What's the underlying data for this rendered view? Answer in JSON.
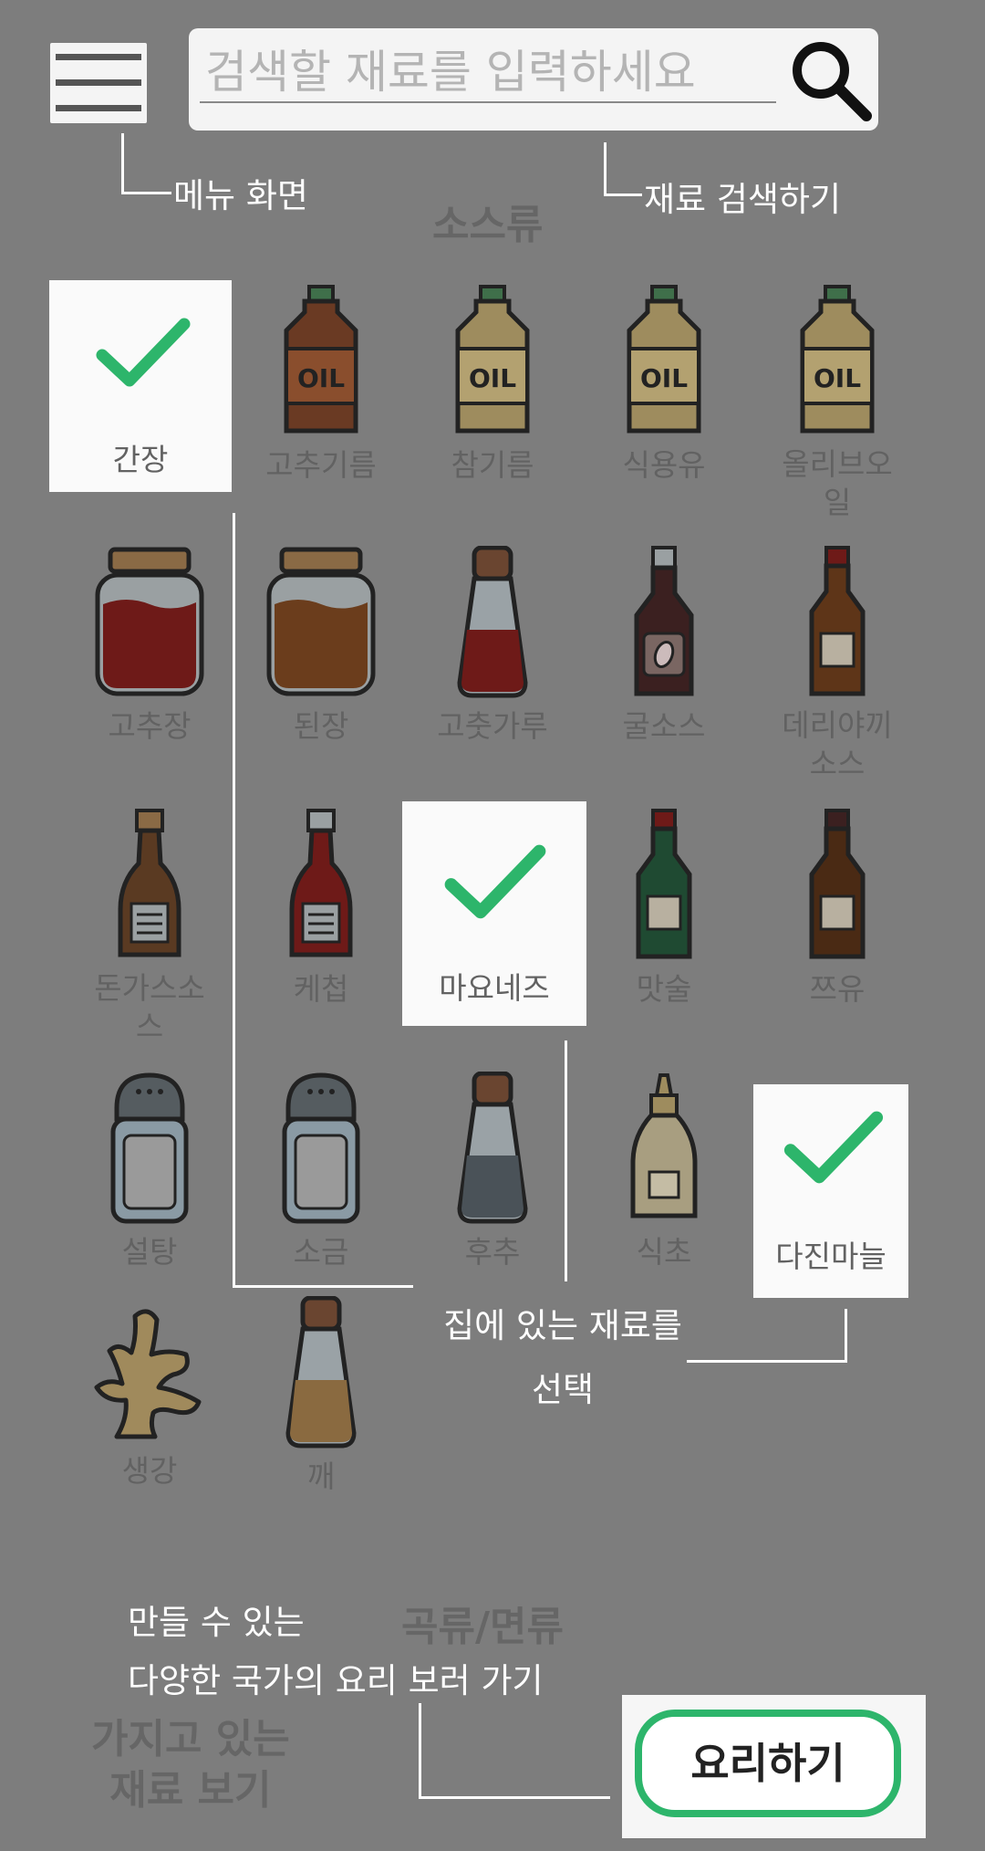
{
  "search": {
    "placeholder": "검색할 재료를 입력하세요"
  },
  "annotations": {
    "menu": "메뉴 화면",
    "search": "재료 검색하기",
    "select_line1": "집에 있는 재료를",
    "select_line2": "선택",
    "cook_line1": "만들 수 있는",
    "cook_line2": "다양한 국가의 요리 보러 가기",
    "owned_line1": "가지고 있는",
    "owned_line2": "재료 보기"
  },
  "sections": {
    "sauce": "소스류",
    "grain": "곡류/면류"
  },
  "ingredients": {
    "soy": "간장",
    "chili_oil": "고추기름",
    "sesame_oil": "참기름",
    "cooking_oil": "식용유",
    "olive_oil_1": "올리브오",
    "olive_oil_2": "일",
    "gochujang": "고추장",
    "doenjang": "된장",
    "chili_powder": "고춧가루",
    "oyster": "굴소스",
    "teriyaki_1": "데리야끼",
    "teriyaki_2": "소스",
    "tonkatsu_1": "돈가스소",
    "tonkatsu_2": "스",
    "ketchup": "케첩",
    "mayo": "마요네즈",
    "mirin": "맛술",
    "tsuyu": "쯔유",
    "sugar": "설탕",
    "salt": "소금",
    "pepper": "후추",
    "vinegar": "식초",
    "garlic": "다진마늘",
    "ginger": "생강",
    "sesame": "깨"
  },
  "selected": [
    "간장",
    "마요네즈",
    "다진마늘"
  ],
  "cook_button": "요리하기",
  "colors": {
    "check": "#2db56b",
    "card": "#fafafa",
    "background": "#7d7d7d"
  }
}
